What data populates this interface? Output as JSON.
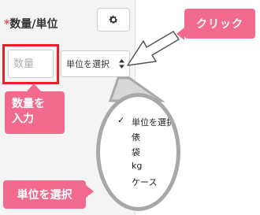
{
  "form": {
    "required_mark": "*",
    "title": "数量/単位",
    "quantity_placeholder": "数量",
    "unit_select_value": "単位を選択"
  },
  "dropdown": {
    "options": [
      "単位を選択",
      "俵",
      "袋",
      "kg",
      "ケース"
    ],
    "selected_index": 0
  },
  "callouts": {
    "click": "クリック",
    "quantity_line1": "数量を",
    "quantity_line2": "入力",
    "unit": "単位を選択"
  },
  "colors": {
    "callout_pink": "#f26b8f",
    "highlight_red": "#e8202a",
    "zoom_ring_gray": "#a8a8a8"
  },
  "icons": [
    "gear-icon",
    "select-arrows-icon",
    "checkmark-icon",
    "pointer-arrow-icon"
  ]
}
